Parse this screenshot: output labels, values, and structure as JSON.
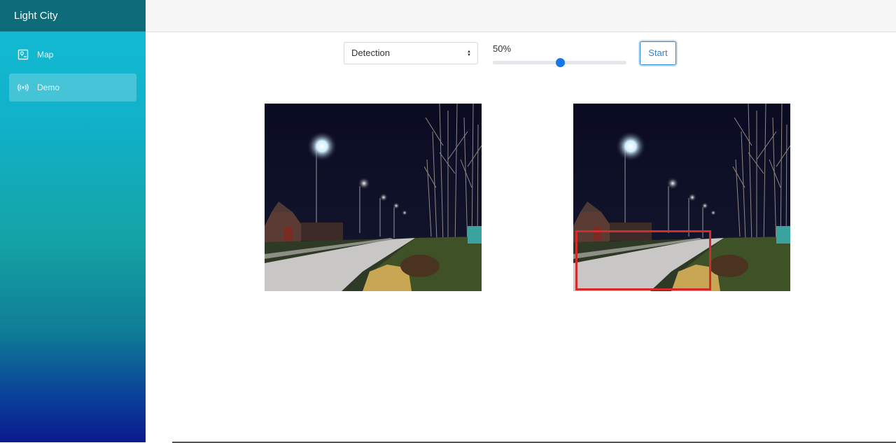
{
  "app": {
    "title": "Light City"
  },
  "sidebar": {
    "items": [
      {
        "label": "Map",
        "icon": "map-icon",
        "active": false
      },
      {
        "label": "Demo",
        "icon": "broadcast-icon",
        "active": true
      }
    ]
  },
  "controls": {
    "mode_select": {
      "value": "Detection"
    },
    "threshold": {
      "label": "50%",
      "value": 0.5
    },
    "start_label": "Start"
  },
  "colors": {
    "accent": "#1877e6",
    "detection_box": "#d42a2a",
    "brand_bar": "#0e6b7a"
  },
  "images": [
    {
      "name": "original-photo",
      "detection": null
    },
    {
      "name": "detected-photo",
      "detection": {
        "label": ""
      }
    }
  ]
}
